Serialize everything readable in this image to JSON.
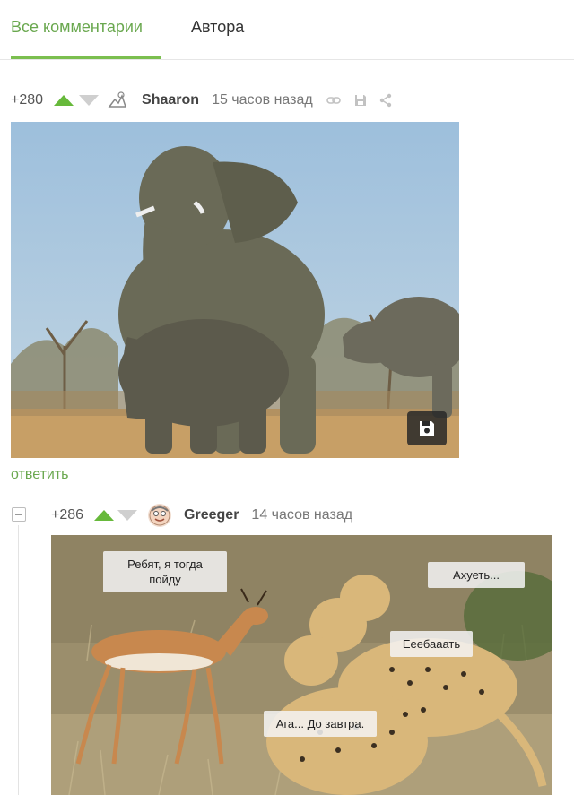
{
  "tabs": [
    {
      "label": "Все комментарии",
      "active": true
    },
    {
      "label": "Автора",
      "active": false
    }
  ],
  "comments": [
    {
      "rating": "+280",
      "author": "Shaaron",
      "time": "15 часов назад",
      "icons": [
        "link-icon",
        "save-icon",
        "share-icon"
      ],
      "reply_label": "ответить"
    },
    {
      "rating": "+286",
      "author": "Greeger",
      "time": "14 часов назад",
      "image_captions": {
        "bubble1": "Ребят, я тогда пойду",
        "bubble2": "Ахуеть...",
        "bubble3": "Еeебааать",
        "bubble4": "Ага... До завтра."
      }
    }
  ],
  "colors": {
    "accent_green": "#6aa84f",
    "upvote_green": "#67b93b",
    "downvote_grey": "#cfcfcf"
  }
}
